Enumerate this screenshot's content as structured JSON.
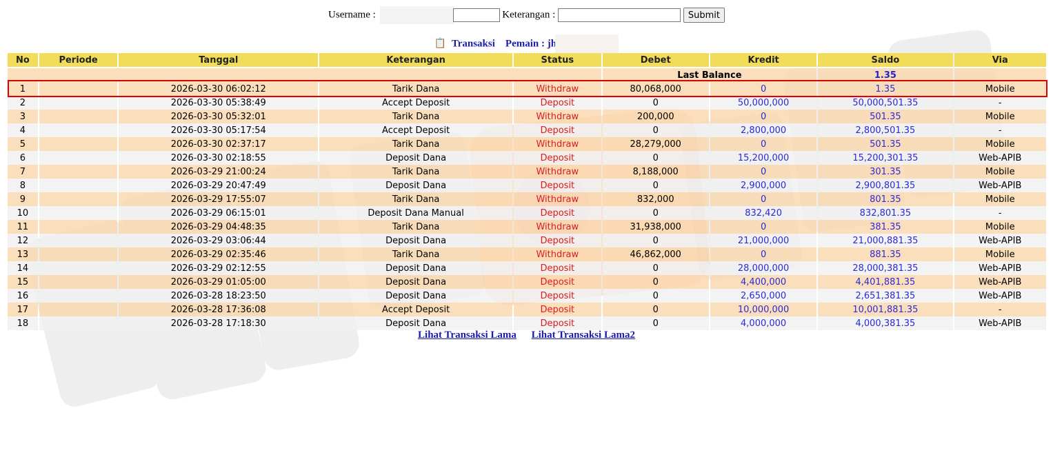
{
  "search": {
    "username_label": "Username :",
    "keterangan_label": "Keterangan :",
    "username_value": "",
    "keterangan_value": "",
    "submit_label": "Submit"
  },
  "heading": {
    "icon": "clipboard-icon",
    "title": "Transaksi",
    "player_label": "Pemain : jh"
  },
  "columns": [
    "No",
    "Periode",
    "Tanggal",
    "Keterangan",
    "Status",
    "Debet",
    "Kredit",
    "Saldo",
    "Via"
  ],
  "last_balance": {
    "label": "Last Balance",
    "value": "1.35"
  },
  "rows": [
    {
      "no": "1",
      "periode": "",
      "tanggal": "2026-03-30 06:02:12",
      "keterangan": "Tarik Dana",
      "status": "Withdraw",
      "debet": "80,068,000",
      "kredit": "0",
      "saldo": "1.35",
      "via": "Mobile"
    },
    {
      "no": "2",
      "periode": "",
      "tanggal": "2026-03-30 05:38:49",
      "keterangan": "Accept Deposit",
      "status": "Deposit",
      "debet": "0",
      "kredit": "50,000,000",
      "saldo": "50,000,501.35",
      "via": "-"
    },
    {
      "no": "3",
      "periode": "",
      "tanggal": "2026-03-30 05:32:01",
      "keterangan": "Tarik Dana",
      "status": "Withdraw",
      "debet": "200,000",
      "kredit": "0",
      "saldo": "501.35",
      "via": "Mobile"
    },
    {
      "no": "4",
      "periode": "",
      "tanggal": "2026-03-30 05:17:54",
      "keterangan": "Accept Deposit",
      "status": "Deposit",
      "debet": "0",
      "kredit": "2,800,000",
      "saldo": "2,800,501.35",
      "via": "-"
    },
    {
      "no": "5",
      "periode": "",
      "tanggal": "2026-03-30 02:37:17",
      "keterangan": "Tarik Dana",
      "status": "Withdraw",
      "debet": "28,279,000",
      "kredit": "0",
      "saldo": "501.35",
      "via": "Mobile"
    },
    {
      "no": "6",
      "periode": "",
      "tanggal": "2026-03-30 02:18:55",
      "keterangan": "Deposit Dana",
      "status": "Deposit",
      "debet": "0",
      "kredit": "15,200,000",
      "saldo": "15,200,301.35",
      "via": "Web-APIB"
    },
    {
      "no": "7",
      "periode": "",
      "tanggal": "2026-03-29 21:00:24",
      "keterangan": "Tarik Dana",
      "status": "Withdraw",
      "debet": "8,188,000",
      "kredit": "0",
      "saldo": "301.35",
      "via": "Mobile"
    },
    {
      "no": "8",
      "periode": "",
      "tanggal": "2026-03-29 20:47:49",
      "keterangan": "Deposit Dana",
      "status": "Deposit",
      "debet": "0",
      "kredit": "2,900,000",
      "saldo": "2,900,801.35",
      "via": "Web-APIB"
    },
    {
      "no": "9",
      "periode": "",
      "tanggal": "2026-03-29 17:55:07",
      "keterangan": "Tarik Dana",
      "status": "Withdraw",
      "debet": "832,000",
      "kredit": "0",
      "saldo": "801.35",
      "via": "Mobile"
    },
    {
      "no": "10",
      "periode": "",
      "tanggal": "2026-03-29 06:15:01",
      "keterangan": "Deposit Dana Manual",
      "status": "Deposit",
      "debet": "0",
      "kredit": "832,420",
      "saldo": "832,801.35",
      "via": "-"
    },
    {
      "no": "11",
      "periode": "",
      "tanggal": "2026-03-29 04:48:35",
      "keterangan": "Tarik Dana",
      "status": "Withdraw",
      "debet": "31,938,000",
      "kredit": "0",
      "saldo": "381.35",
      "via": "Mobile"
    },
    {
      "no": "12",
      "periode": "",
      "tanggal": "2026-03-29 03:06:44",
      "keterangan": "Deposit Dana",
      "status": "Deposit",
      "debet": "0",
      "kredit": "21,000,000",
      "saldo": "21,000,881.35",
      "via": "Web-APIB"
    },
    {
      "no": "13",
      "periode": "",
      "tanggal": "2026-03-29 02:35:46",
      "keterangan": "Tarik Dana",
      "status": "Withdraw",
      "debet": "46,862,000",
      "kredit": "0",
      "saldo": "881.35",
      "via": "Mobile"
    },
    {
      "no": "14",
      "periode": "",
      "tanggal": "2026-03-29 02:12:55",
      "keterangan": "Deposit Dana",
      "status": "Deposit",
      "debet": "0",
      "kredit": "28,000,000",
      "saldo": "28,000,381.35",
      "via": "Web-APIB"
    },
    {
      "no": "15",
      "periode": "",
      "tanggal": "2026-03-29 01:05:00",
      "keterangan": "Deposit Dana",
      "status": "Deposit",
      "debet": "0",
      "kredit": "4,400,000",
      "saldo": "4,401,881.35",
      "via": "Web-APIB"
    },
    {
      "no": "16",
      "periode": "",
      "tanggal": "2026-03-28 18:23:50",
      "keterangan": "Deposit Dana",
      "status": "Deposit",
      "debet": "0",
      "kredit": "2,650,000",
      "saldo": "2,651,381.35",
      "via": "Web-APIB"
    },
    {
      "no": "17",
      "periode": "",
      "tanggal": "2026-03-28 17:36:08",
      "keterangan": "Accept Deposit",
      "status": "Deposit",
      "debet": "0",
      "kredit": "10,000,000",
      "saldo": "10,001,881.35",
      "via": "-"
    },
    {
      "no": "18",
      "periode": "",
      "tanggal": "2026-03-28 17:18:30",
      "keterangan": "Deposit Dana",
      "status": "Deposit",
      "debet": "0",
      "kredit": "4,000,000",
      "saldo": "4,000,381.35",
      "via": "Web-APIB"
    }
  ],
  "links": {
    "old": "Lihat Transaksi Lama",
    "old2": "Lihat Transaksi Lama2"
  },
  "colors": {
    "header_bg": "#f1dd5a",
    "row_peach": "#fad7ac",
    "row_gray": "#f0f0f0",
    "withdraw": "#d62020",
    "blue": "#2a2ad8",
    "highlight": "#e00000"
  }
}
